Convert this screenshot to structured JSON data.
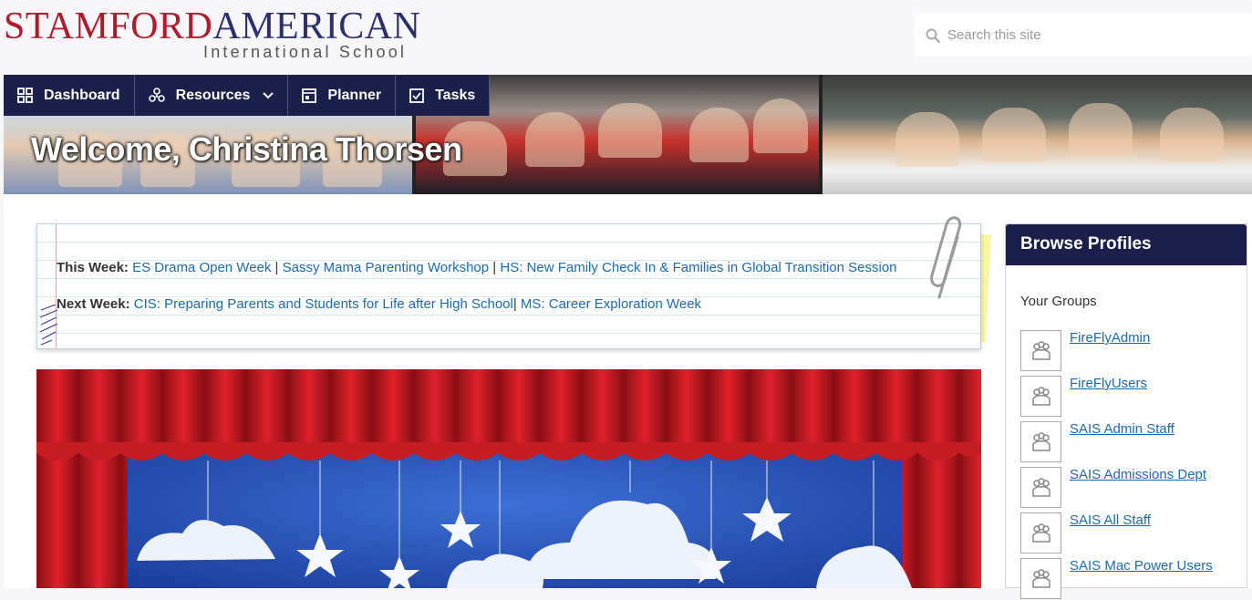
{
  "logo": {
    "part1": "STAMFORD",
    "part2": "AMERICAN",
    "subtitle": "International School",
    "color_red": "#b11a2d",
    "color_navy": "#2b2f6b"
  },
  "search": {
    "placeholder": "Search this site",
    "icon": "search-icon"
  },
  "nav": {
    "items": [
      {
        "label": "Dashboard",
        "icon": "grid-icon"
      },
      {
        "label": "Resources",
        "icon": "resources-icon",
        "dropdown": true
      },
      {
        "label": "Planner",
        "icon": "planner-icon"
      },
      {
        "label": "Tasks",
        "icon": "checkbox-icon"
      }
    ],
    "background": "#1b1f4a"
  },
  "banner": {
    "welcome": "Welcome, Christina Thorsen"
  },
  "notepad": {
    "this_week_label": "This Week:",
    "this_week_links": [
      "ES Drama Open Week",
      "Sassy Mama Parenting Workshop",
      "HS: New Family Check In & Families in Global Transition Session"
    ],
    "next_week_label": "Next Week:",
    "next_week_links": [
      "CIS: Preparing Parents and Students for Life after High School",
      "MS: Career Exploration Week"
    ],
    "separator": " | "
  },
  "sidebar": {
    "title": "Browse Profiles",
    "groups_title": "Your Groups",
    "groups": [
      {
        "name": "FireFlyAdmin"
      },
      {
        "name": "FireFlyUsers"
      },
      {
        "name": "SAIS Admin Staff"
      },
      {
        "name": "SAIS Admissions Dept"
      },
      {
        "name": "SAIS All Staff"
      },
      {
        "name": "SAIS Mac Power Users"
      }
    ]
  },
  "colors": {
    "link": "#1a6bb3",
    "header_navy": "#1b1f4a"
  }
}
